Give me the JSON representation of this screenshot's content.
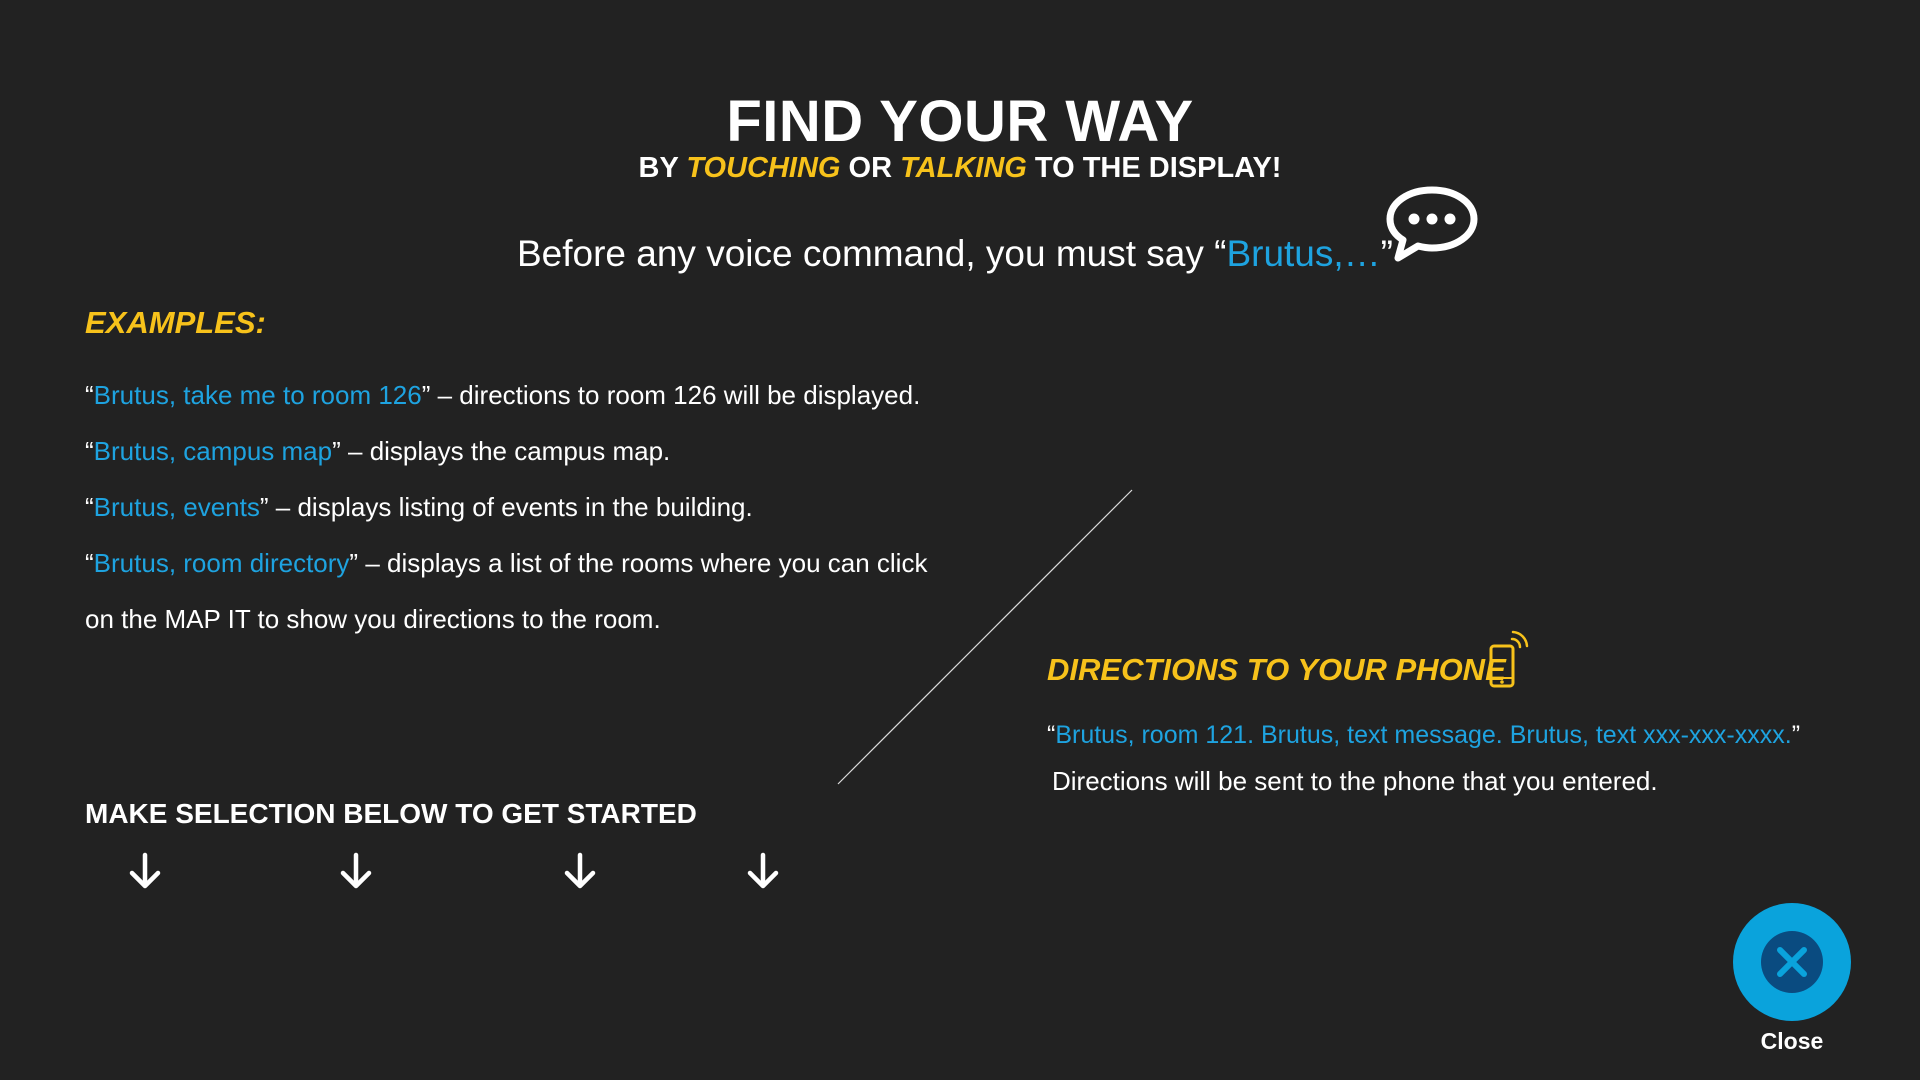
{
  "header": {
    "title": "FIND YOUR WAY",
    "subtitle": {
      "part1": "BY ",
      "touching": "TOUCHING",
      "part2": " OR ",
      "talking": "TALKING",
      "part3": " TO THE DISPLAY!"
    },
    "voice_instruction": {
      "prefix": "Before any voice command, you must say “",
      "keyword": "Brutus,…",
      "suffix": "”"
    }
  },
  "examples": {
    "heading": "EXAMPLES:",
    "items": [
      {
        "open": "“",
        "command": "Brutus, take me to room 126",
        "close": "”",
        "description": " – directions to room 126 will be displayed."
      },
      {
        "open": "“",
        "command": "Brutus, campus map",
        "close": "”",
        "description": " – displays the campus map."
      },
      {
        "open": "“",
        "command": "Brutus, events",
        "close": "”",
        "description": " – displays listing of events in the building."
      },
      {
        "open": "“",
        "command": "Brutus, room directory",
        "close": "”",
        "description": " – displays a list of the rooms where you can click"
      }
    ],
    "continuation": "on the MAP IT to show you directions to the room."
  },
  "phone": {
    "heading": "DIRECTIONS TO YOUR PHONE",
    "example_open": "“",
    "example_command": "Brutus, room 121.  Brutus, text message.  Brutus, text xxx-xxx-xxxx.",
    "example_close": "”",
    "note": "Directions will be sent to the phone that you entered."
  },
  "selection": {
    "heading": "MAKE SELECTION BELOW TO GET STARTED"
  },
  "close_button": {
    "label": "Close"
  },
  "icons": {
    "speech": "speech-bubble-icon",
    "phone": "smartphone-icon",
    "arrow": "arrow-down-icon",
    "close": "close-icon"
  },
  "colors": {
    "background": "#222222",
    "accent_yellow": "#f7c21b",
    "accent_blue": "#1ea3e0",
    "close_outer": "#0aa3dc",
    "close_inner": "#0a4b80"
  }
}
